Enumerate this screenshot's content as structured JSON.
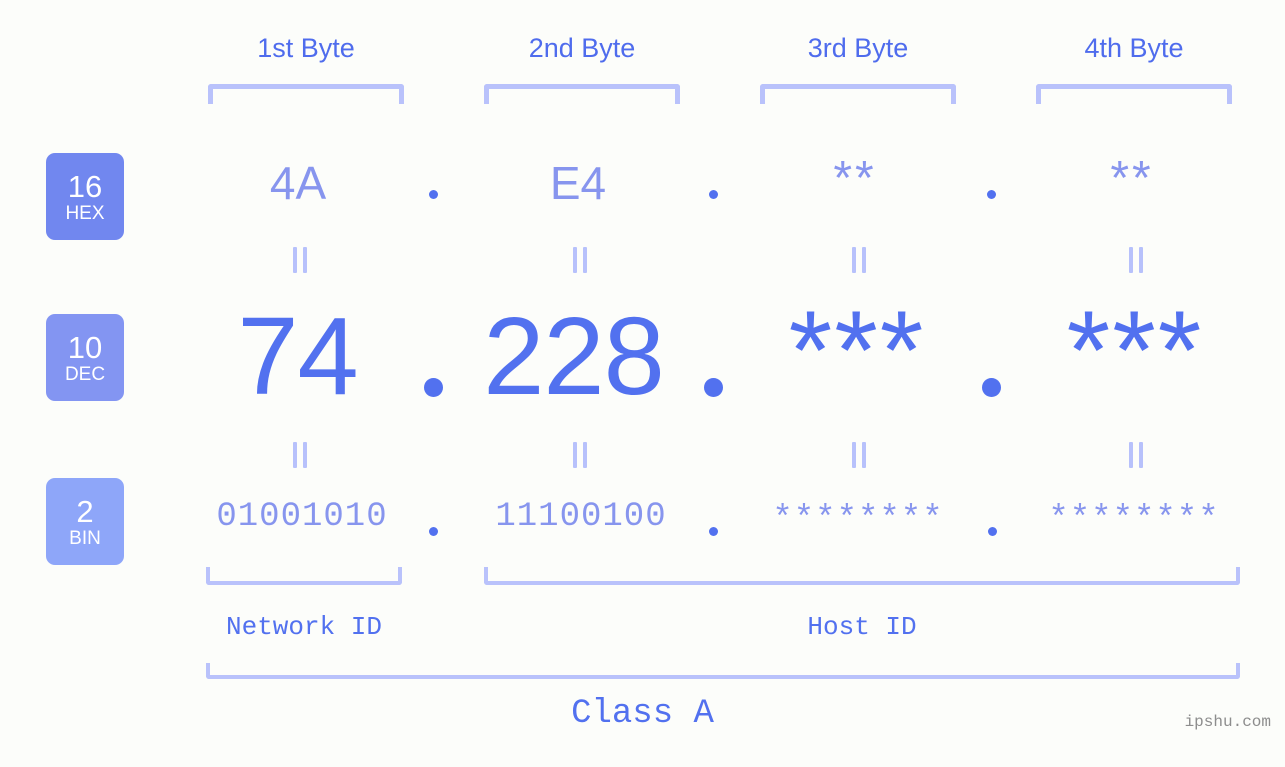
{
  "background_color": "#fcfdfa",
  "accent_color": "#5271ef",
  "accent_light_color": "#8795ee",
  "bracket_color": "#b9c2fb",
  "byte_headers": [
    {
      "label": "1st Byte"
    },
    {
      "label": "2nd Byte"
    },
    {
      "label": "3rd Byte"
    },
    {
      "label": "4th Byte"
    }
  ],
  "rows": [
    {
      "badge": {
        "number": "16",
        "name": "HEX",
        "color": "#7187ef"
      },
      "values": [
        "4A",
        "E4",
        "**",
        "**"
      ],
      "separators": [
        ".",
        ".",
        "."
      ]
    },
    {
      "badge": {
        "number": "10",
        "name": "DEC",
        "color": "#8395f2"
      },
      "values": [
        "74",
        "228",
        "***",
        "***"
      ],
      "separators": [
        ".",
        ".",
        "."
      ]
    },
    {
      "badge": {
        "number": "2",
        "name": "BIN",
        "color": "#8ea6f9"
      },
      "values": [
        "01001010",
        "11100100",
        "********",
        "********"
      ],
      "separators": [
        ".",
        ".",
        "."
      ]
    }
  ],
  "equals_marks": [
    "||",
    "||",
    "||",
    "||",
    "||",
    "||",
    "||",
    "||"
  ],
  "id_sections": [
    {
      "label": "Network ID"
    },
    {
      "label": "Host ID"
    }
  ],
  "class": {
    "label": "Class A"
  },
  "watermark": {
    "text": "ipshu.com"
  }
}
